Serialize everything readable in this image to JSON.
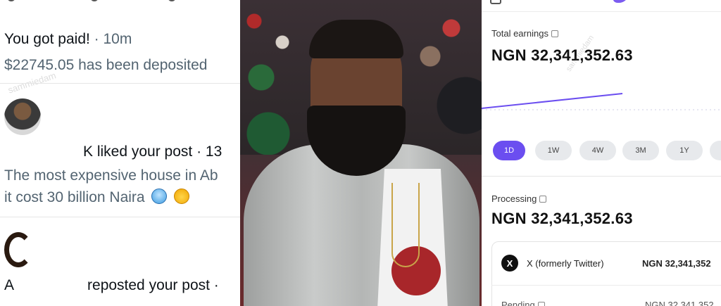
{
  "left_panel": {
    "notification_1": {
      "title": "You got paid!",
      "time": " · 10m",
      "body": "$22745.05 has been deposited"
    },
    "notification_2": {
      "actor": "K",
      "action": " liked your post · 13",
      "text_line1": "The most expensive house in Ab",
      "text_line2": "it cost 30 billion Naira",
      "emoji_1": "cold-face-emoji",
      "emoji_2": "exploding-head-emoji"
    },
    "notification_3": {
      "actor": "A",
      "action": "reposted your post ·"
    },
    "watermark": "sammiedam"
  },
  "right_panel": {
    "total_earnings_label": "Total earnings",
    "total_earnings_value": "NGN 32,341,352.63",
    "range_options": [
      "1D",
      "1W",
      "4W",
      "3M",
      "1Y"
    ],
    "selected_range": "1D",
    "processing_label": "Processing",
    "processing_value": "NGN 32,341,352.63",
    "source_name": "X (formerly Twitter)",
    "source_amount": "NGN 32,341,352",
    "pending_label": "Pending",
    "pending_amount": "NGN 32,341,352",
    "accent_color": "#6b4ef0"
  }
}
